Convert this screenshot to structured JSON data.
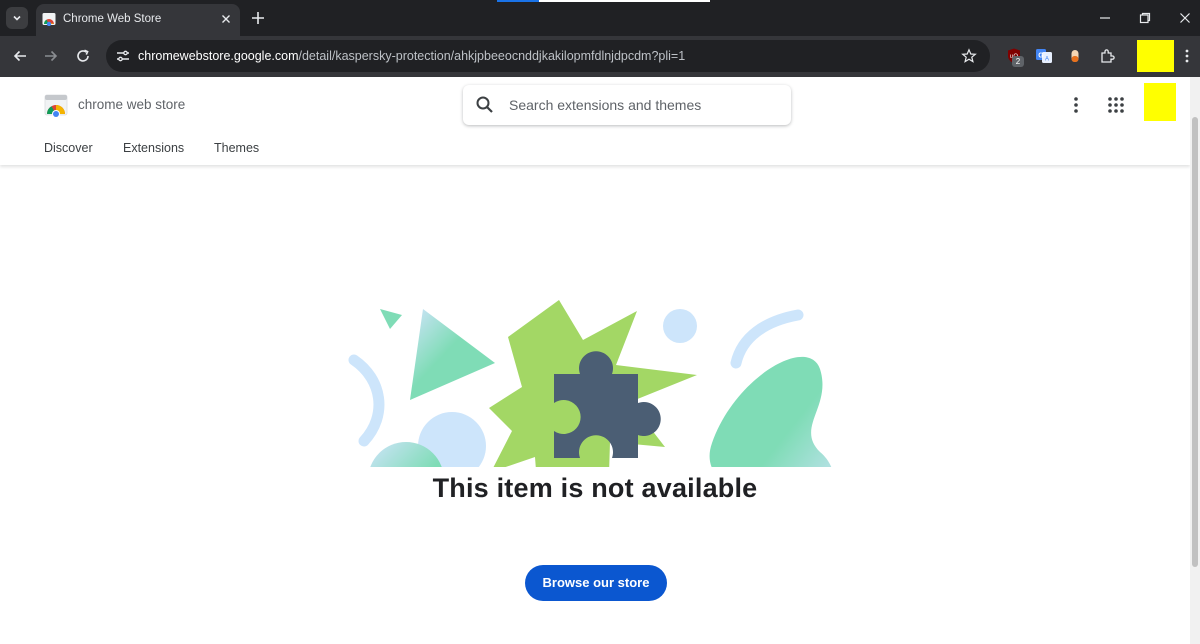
{
  "browser": {
    "tab": {
      "title": "Chrome Web Store"
    },
    "omnibox": {
      "url_host": "chromewebstore.google.com",
      "url_path": "/detail/kaspersky-protection/ahkjpbeeocnddjkakilopmfdlnjdpcdm?pli=1"
    },
    "extensions": {
      "badge_count": "2"
    }
  },
  "store": {
    "name": "chrome web store",
    "search": {
      "placeholder": "Search extensions and themes",
      "value": ""
    },
    "nav": [
      "Discover",
      "Extensions",
      "Themes"
    ]
  },
  "main": {
    "message": "This item is not available",
    "browse_button": "Browse our store"
  },
  "colors": {
    "accent": "#0b57d0",
    "browser_frame": "#202124",
    "toolbar": "#35363a",
    "illustration_green": "#a3d765",
    "illustration_teal": "#7fdcb6",
    "illustration_light_blue": "#cde5fb",
    "puzzle": "#4b5e74"
  },
  "icons": {
    "tab_search": "chevron-down-icon",
    "new_tab": "plus-icon",
    "back": "arrow-left-icon",
    "forward": "arrow-right-icon",
    "reload": "reload-icon",
    "site_info": "tune-icon",
    "bookmark": "star-icon",
    "puzzle": "puzzle-icon",
    "search": "search-icon",
    "more": "more-vert-icon",
    "apps": "apps-grid-icon"
  }
}
